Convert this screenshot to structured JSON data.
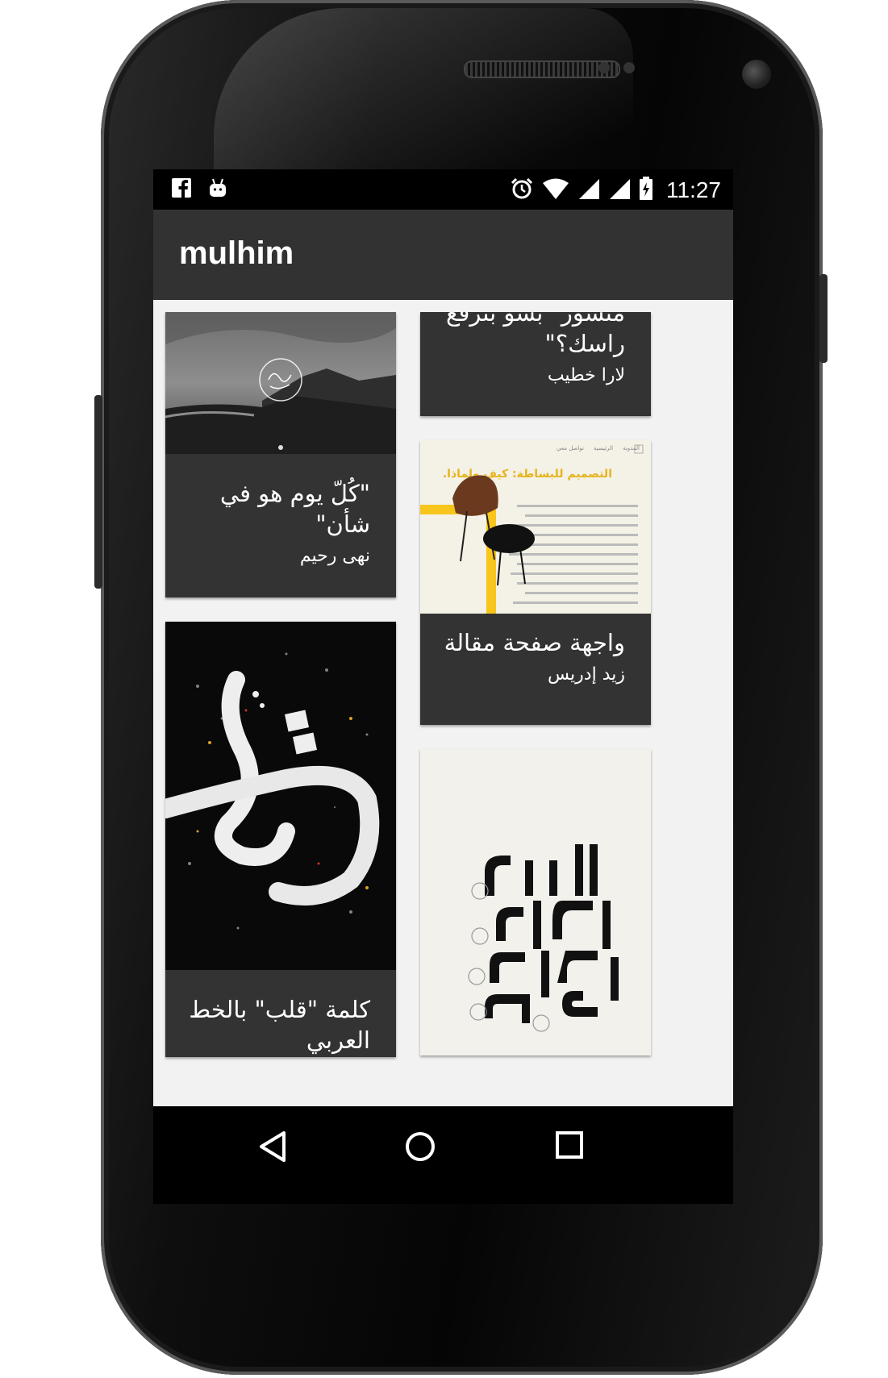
{
  "status_bar": {
    "notification_icons": [
      "facebook-icon",
      "android-icon"
    ],
    "system_icons": [
      "alarm-icon",
      "wifi-icon",
      "signal-icon",
      "signal-icon",
      "battery-charging-icon"
    ],
    "time": "11:27"
  },
  "app_bar": {
    "title": "mulhim"
  },
  "cards": [
    {
      "title": "منشور \"بشو بترفع راسك؟\"",
      "author": "لارا خطيب",
      "image": "none"
    },
    {
      "title": "\"كُلّ يوم هو في شأن\"",
      "author": "نهى رحيم",
      "image": "landscape-calligraphy-photo"
    },
    {
      "title": "واجهة صفحة مقالة",
      "author": "زيد إدريس",
      "image": "article-page-mockup"
    },
    {
      "title": "كلمة \"قلب\" بالخط العربي",
      "author": "",
      "image": "calligraphy-qalb"
    },
    {
      "title": "",
      "author": "",
      "image": "arabic-typography-poster"
    }
  ],
  "mockup_text": {
    "nav": [
      "تواصل معي",
      "الرئيسية",
      "المدونة"
    ],
    "headline": "التصميم للبساطة: كيف ولماذا."
  },
  "nav_bar": {
    "back": "back-icon",
    "home": "home-icon",
    "recents": "recents-icon"
  },
  "colors": {
    "app_bar": "#323232",
    "card": "#333333",
    "background": "#f2f2f2",
    "accent_yellow": "#f7c51c"
  }
}
